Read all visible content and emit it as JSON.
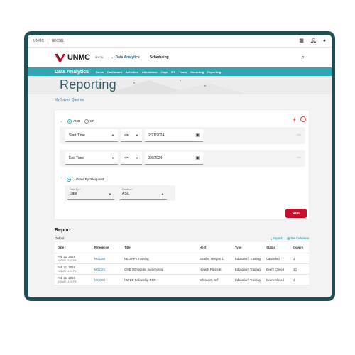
{
  "topbar": {
    "left1": "UNMC",
    "left2": "IEXCEL"
  },
  "header": {
    "logo_text": "UNMC",
    "logo_sub": "IEXCEL",
    "nav_drop": "Data Analytics",
    "nav_sched": "Scheduling"
  },
  "tealbar": {
    "title": "Data Analytics",
    "links": [
      "Home",
      "Dashboard",
      "Activities",
      "Attendance",
      "Orgs",
      "IPE",
      "Tours",
      "Marketing",
      "Reporting"
    ]
  },
  "page": {
    "title": "Reporting",
    "saved_link": "My Saved Queries"
  },
  "query": {
    "and_label": "AND",
    "or_label": "OR",
    "filters": [
      {
        "field": "Start Time",
        "op": "<=",
        "value": "2/21/2024"
      },
      {
        "field": "End Time",
        "op": "<=",
        "value": "3/6/2024"
      }
    ],
    "order_label": "Order By *Required",
    "order_by_label": "Order By *",
    "order_by_value": "Date",
    "direction_label": "Direction *",
    "direction_value": "ASC",
    "run_label": "Run"
  },
  "report": {
    "title": "Report",
    "output_label": "Output",
    "export_label": "Export",
    "columns_label": "Set Columns",
    "headers": [
      "Date",
      "Reference",
      "Title",
      "Host",
      "Type",
      "Status",
      "Covers"
    ],
    "rows": [
      {
        "date": "Feb 21, 2024",
        "time": "8:00 AM - 5:00 PM",
        "ref": "M01288",
        "title": "NEU PPE Training",
        "host": "Strader, Morgan J.",
        "type": "Education/ Training",
        "status": "Cancelled",
        "covers": "1"
      },
      {
        "date": "Feb 21, 2024",
        "time": "8:00 AM - 4:00 PM",
        "ref": "M01174",
        "title": "GME Orthopedic Surgery Imp",
        "host": "Howell, Payne E.",
        "type": "Education/ Training",
        "status": "Event Closed",
        "covers": "10"
      },
      {
        "date": "Feb 21, 2024",
        "time": "8:00 AM - 4:00 PM",
        "ref": "M02994",
        "title": "NM ED Fellowship RNR",
        "host": "Whisnant, Jeff",
        "type": "Education/ Training",
        "status": "Event Closed",
        "covers": "4"
      }
    ]
  },
  "colors": {
    "frame": "#1f4e55",
    "teal": "#2fa7b2",
    "brand_red": "#c8102e",
    "heading": "#2c5d68",
    "link": "#2f7fb6"
  },
  "icons": [
    "grid-icon",
    "bell-icon",
    "user-icon",
    "search-icon",
    "chevron-down-icon",
    "plus-icon",
    "remove-icon",
    "calendar-icon",
    "kebab-icon",
    "export-icon",
    "columns-icon",
    "sort-arrow-icon"
  ]
}
